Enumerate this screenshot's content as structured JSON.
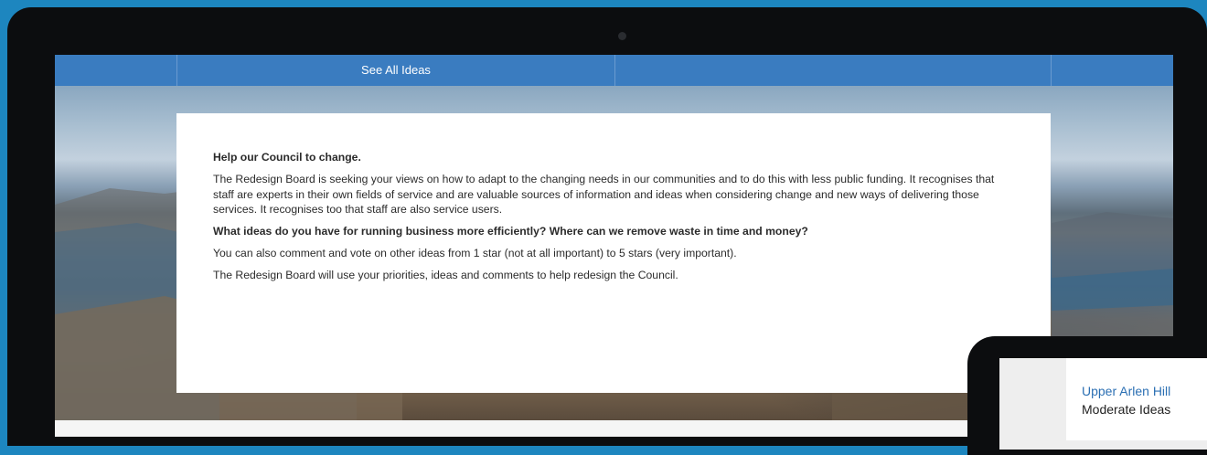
{
  "nav": {
    "link_label": "See All Ideas"
  },
  "intro": {
    "heading": "Help our Council to change.",
    "body": "The Redesign Board is seeking your views on how to adapt to the changing needs in our communities and to do this with less public funding.  It recognises that staff are experts in their own fields of service and are valuable sources of information and ideas when considering change and new ways of delivering those services. It recognises too that staff are also service users.",
    "question": "What ideas do you have for running business more efficiently? Where can we remove waste in time and money?",
    "voting": "You can also comment and vote on other ideas from 1 star (not at all important) to 5 stars (very important).",
    "closing": "The Redesign Board will use your priorities, ideas and comments to help redesign the Council."
  },
  "mobile": {
    "link": "Upper Arlen Hill",
    "subtitle": "Moderate Ideas"
  },
  "colors": {
    "background": "#1d86bf",
    "nav": "#3a7cc0",
    "link": "#2b6fb3"
  }
}
